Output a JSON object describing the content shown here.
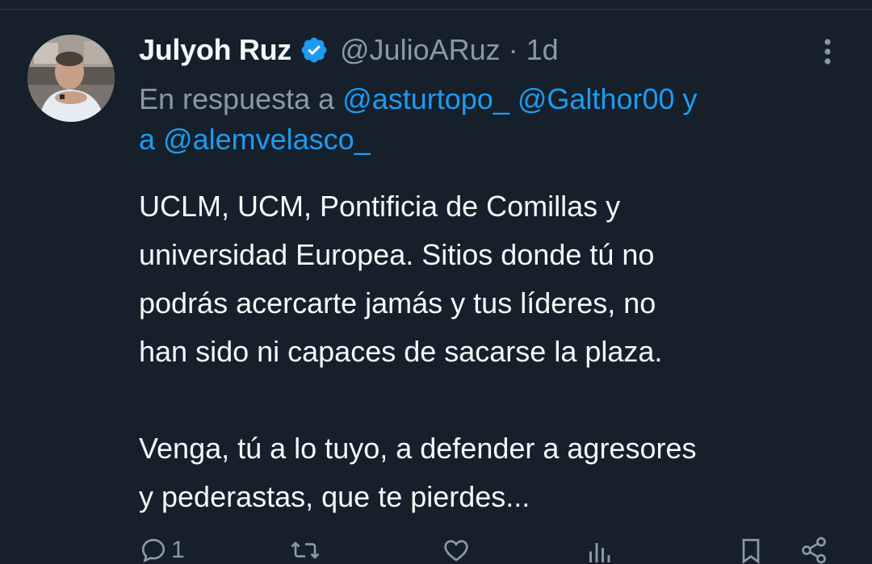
{
  "tweet": {
    "display_name": "Julyoh Ruz",
    "handle": "@JulioARuz",
    "separator": "·",
    "time": "1d",
    "reply_prefix": "En respuesta a",
    "mentions": [
      "@asturtopo_",
      "@Galthor00",
      "@alemvelasco_"
    ],
    "reply_join_1": "y",
    "reply_join_2": "a",
    "body_lines": [
      "UCLM, UCM, Pontificia de Comillas y",
      "universidad Europea. Sitios donde tú no",
      "podrás acercarte jamás y tus líderes, no",
      "han sido ni capaces de sacarse la plaza.",
      "Venga, tú a lo tuyo, a defender a agresores",
      "y pederastas, que te pierdes..."
    ],
    "reply_count": "1"
  },
  "icons": {
    "verified": "verified-badge-icon",
    "more": "more-vertical-icon",
    "reply": "reply-icon",
    "retweet": "retweet-icon",
    "like": "like-icon",
    "views": "views-icon",
    "bookmark": "bookmark-icon",
    "share": "share-icon"
  },
  "colors": {
    "background": "#15202b",
    "text": "#f7f9f9",
    "muted": "#8b98a5",
    "accent": "#1d9bf0"
  }
}
